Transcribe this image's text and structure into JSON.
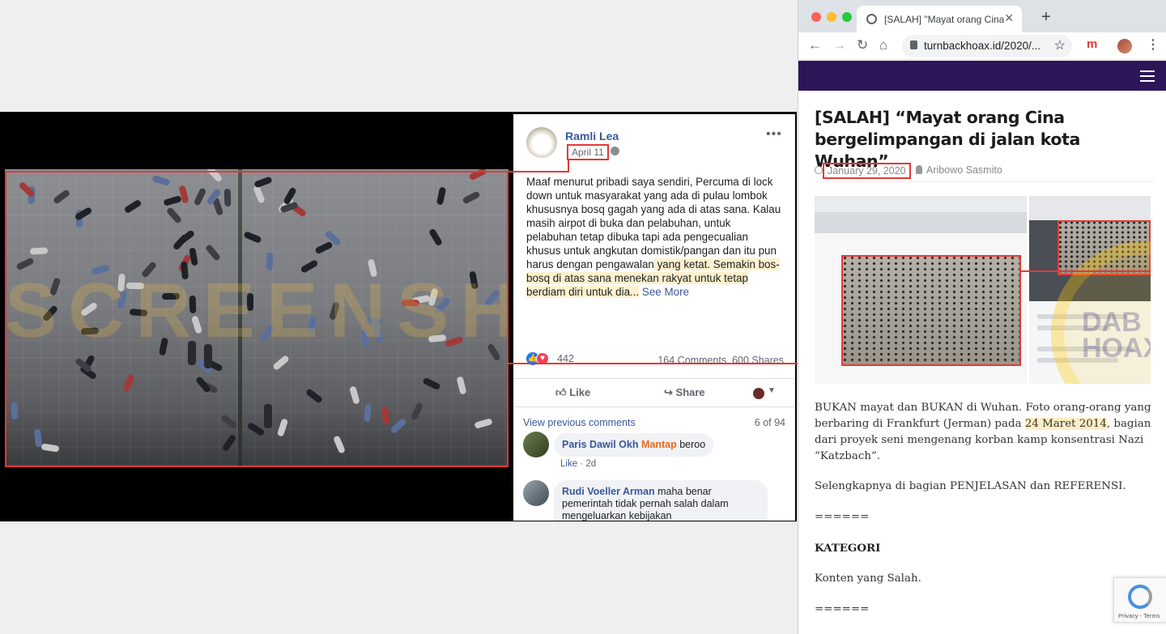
{
  "facebook": {
    "author": "Ramli Lea",
    "date": "April 11",
    "more": "•••",
    "post_text": "Maaf menurut pribadi saya sendiri, Percuma di lock down untuk masyarakat yang ada di pulau lombok khususnya bosq gagah yang ada di atas sana. Kalau masih airpot di buka dan pelabuhan, untuk pelabuhan tetap dibuka tapi ada pengecualian khusus untuk angkutan domistik/pangan dan itu pun harus dengan pengawalan",
    "post_text_hl": " yang ketat. Semakin bos-bosq di atas sana menekan rakyat untuk tetap berdiam diri untuk dia...",
    "see_more": "See More",
    "reaction_count": "442",
    "comments_stat": "164 Comments",
    "shares_stat": "600 Shares",
    "like_label": "Like",
    "share_label": "Share",
    "view_previous": "View previous comments",
    "comment_page": "6 of 94",
    "comments": [
      {
        "name": "Paris Dawil Okh",
        "tag": "Mantap",
        "text": " beroo",
        "like": "Like",
        "time": "2d"
      },
      {
        "name": "Rudi Voeller Arman",
        "text": " maha benar pemerintah tidak pernah salah dalam mengeluarkan kebijakan"
      }
    ]
  },
  "browser": {
    "tab_title": "[SALAH] \"Mayat orang Cina bergelimpangan di jalan kota Wuhan\"",
    "tab_close": "✕",
    "new_tab": "+",
    "url": "turnbackhoax.id/2020/...",
    "ext_m": "m",
    "back": "←",
    "forward": "→",
    "reload": "↻",
    "home": "⌂",
    "star": "☆",
    "menu": "⋮"
  },
  "article": {
    "title": "[SALAH] “Mayat orang Cina bergelimpangan di jalan kota Wuhan”",
    "date": "January 29, 2020",
    "author": "Aribowo Sasmito",
    "p1_a": "BUKAN mayat dan BUKAN di Wuhan. Foto orang-orang yang berbaring di Frankfurt (Jerman) pada ",
    "p1_date": "24 Maret 2014",
    "p1_b": ", bagian dari proyek seni mengenang korban kamp konsentrasi Nazi “Katzbach”.",
    "p2": "Selengkapnya di bagian PENJELASAN dan REFERENSI.",
    "sep": "======",
    "kategori": "KATEGORI",
    "p3": "Konten yang Salah.",
    "sep2": "======",
    "recaptcha": "Privacy - Terms"
  },
  "colors": {
    "highlight_red": "#e53935",
    "fb_blue": "#385898",
    "site_purple": "#2d1558"
  }
}
